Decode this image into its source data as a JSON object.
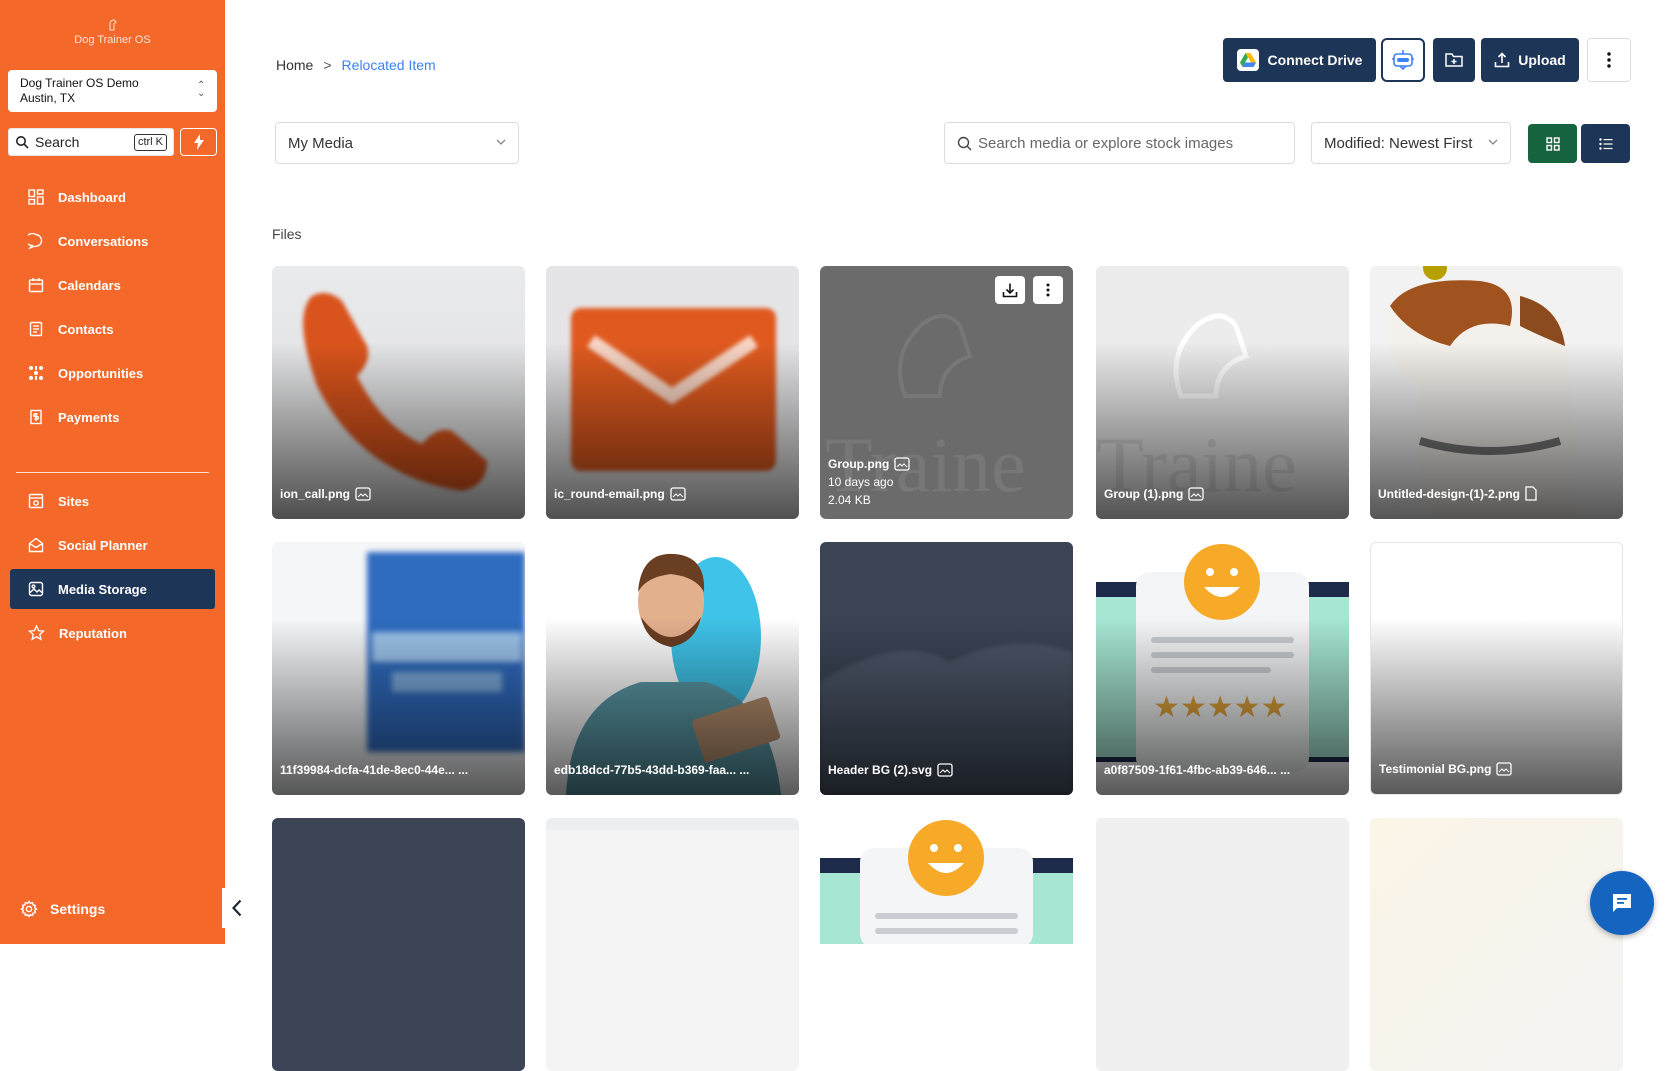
{
  "sidebar": {
    "brand": "Dog Trainer OS",
    "location": {
      "name": "Dog Trainer OS Demo",
      "city": "Austin, TX"
    },
    "search": {
      "label": "Search",
      "shortcut": "ctrl K"
    },
    "nav_primary": [
      {
        "label": "Dashboard",
        "icon": "dashboard-icon"
      },
      {
        "label": "Conversations",
        "icon": "chat-bubble-icon"
      },
      {
        "label": "Calendars",
        "icon": "calendar-icon"
      },
      {
        "label": "Contacts",
        "icon": "contacts-icon"
      },
      {
        "label": "Opportunities",
        "icon": "opportunities-icon"
      },
      {
        "label": "Payments",
        "icon": "payments-icon"
      }
    ],
    "nav_secondary": [
      {
        "label": "Sites",
        "icon": "sites-icon"
      },
      {
        "label": "Social Planner",
        "icon": "social-icon"
      },
      {
        "label": "Media Storage",
        "icon": "image-icon",
        "active": true
      },
      {
        "label": "Reputation",
        "icon": "star-icon"
      }
    ],
    "settings": "Settings"
  },
  "header": {
    "breadcrumb": {
      "home": "Home",
      "separator": ">",
      "current": "Relocated Item"
    },
    "connect_drive": "Connect Drive",
    "upload": "Upload"
  },
  "toolbar": {
    "media_select": "My Media",
    "search_placeholder": "Search media or explore stock images",
    "sort": "Modified: Newest First"
  },
  "files": {
    "label": "Files",
    "items": [
      {
        "name": "ion_call.png"
      },
      {
        "name": "ic_round-email.png"
      },
      {
        "name": "Group.png",
        "modified": "10 days ago",
        "size": "2.04 KB"
      },
      {
        "name": "Group (1).png"
      },
      {
        "name": "Untitled-design-(1)-2.png"
      },
      {
        "name": "11f39984-dcfa-41de-8ec0-44e... ..."
      },
      {
        "name": "edb18dcd-77b5-43dd-b369-faa... ..."
      },
      {
        "name": "Header BG (2).svg"
      },
      {
        "name": "a0f87509-1f61-4fbc-ab39-646... ..."
      },
      {
        "name": "Testimonial BG.png"
      }
    ]
  },
  "colors": {
    "sidebar": "#f4682a",
    "navy": "#1d3557",
    "green": "#16633f",
    "link": "#3b82f6"
  }
}
